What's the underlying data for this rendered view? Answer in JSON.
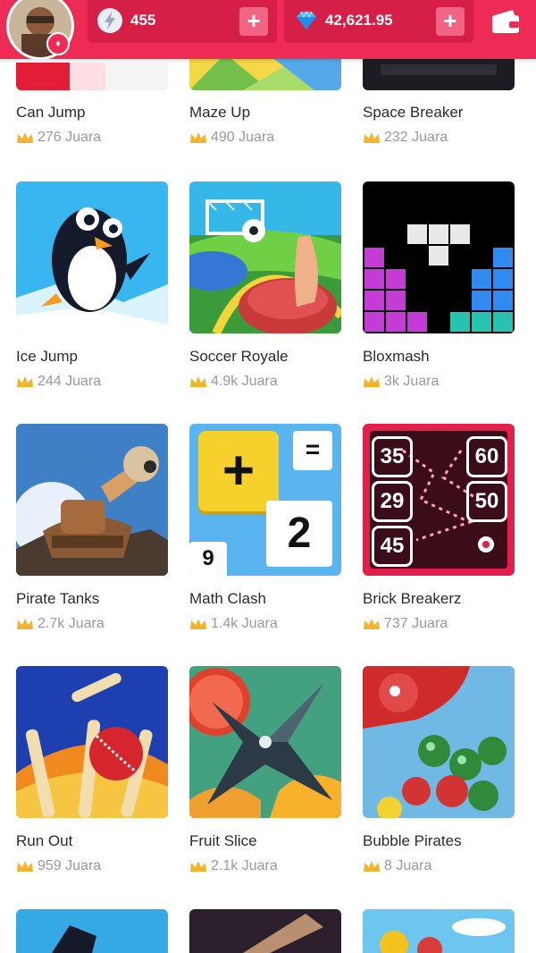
{
  "header": {
    "energy": {
      "value": "455",
      "icon": "lightning-icon"
    },
    "gems": {
      "value": "42,621.95",
      "icon": "diamond-icon"
    },
    "add_label": "+",
    "wallet_icon": "wallet-icon",
    "brand_color": "#ed2b55"
  },
  "games": [
    {
      "name": "Can Jump",
      "champions": "276 Juara"
    },
    {
      "name": "Maze Up",
      "champions": "490 Juara"
    },
    {
      "name": "Space Breaker",
      "champions": "232 Juara"
    },
    {
      "name": "Ice Jump",
      "champions": "244 Juara"
    },
    {
      "name": "Soccer Royale",
      "champions": "4.9k Juara"
    },
    {
      "name": "Bloxmash",
      "champions": "3k Juara"
    },
    {
      "name": "Pirate Tanks",
      "champions": "2.7k Juara"
    },
    {
      "name": "Math Clash",
      "champions": "1.4k Juara"
    },
    {
      "name": "Brick Breakerz",
      "champions": "737 Juara"
    },
    {
      "name": "Run Out",
      "champions": "959 Juara"
    },
    {
      "name": "Fruit Slice",
      "champions": "2.1k Juara"
    },
    {
      "name": "Bubble Pirates",
      "champions": "8 Juara"
    }
  ],
  "thumb_text": {
    "math_plus": "+",
    "math_equals": "=",
    "math_two": "2",
    "math_nine": "9",
    "brick_numbers": [
      "35",
      "60",
      "29",
      "50",
      "45"
    ]
  }
}
